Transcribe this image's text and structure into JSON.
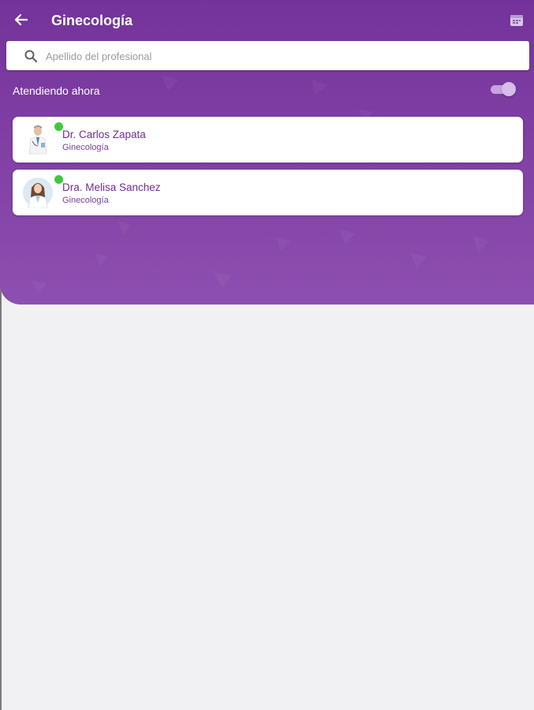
{
  "header": {
    "title": "Ginecología",
    "back_icon": "arrow-left-icon",
    "calendar_icon": "calendar-icon"
  },
  "search": {
    "placeholder": "Apellido del profesional",
    "value": "",
    "icon": "search-icon"
  },
  "filter": {
    "label": "Atendiendo ahora",
    "enabled": true
  },
  "doctors": [
    {
      "name": "Dr. Carlos Zapata",
      "specialty": "Ginecología",
      "online": true
    },
    {
      "name": "Dra. Melisa Sanchez",
      "specialty": "Ginecología",
      "online": true
    }
  ],
  "colors": {
    "brand_purple": "#7f3fa3",
    "online_green": "#3ec93b",
    "background": "#f1f1f3"
  }
}
